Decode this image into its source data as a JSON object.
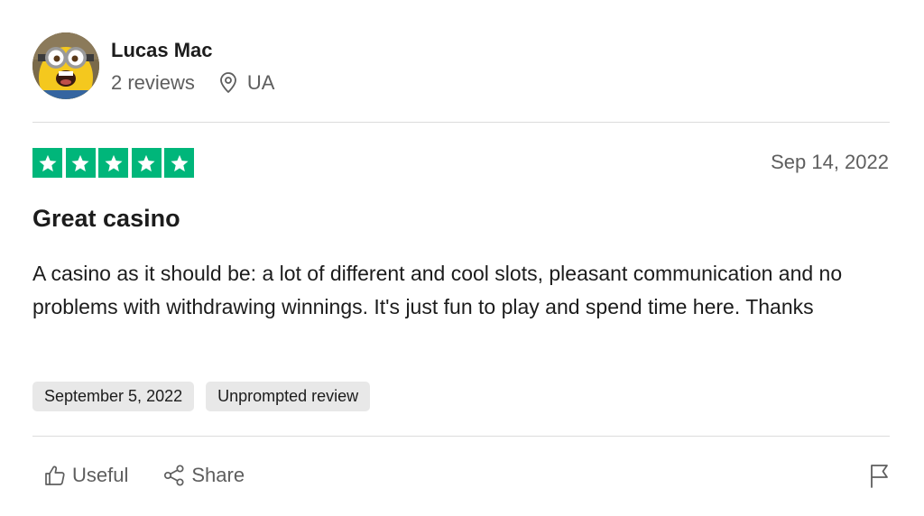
{
  "reviewer": {
    "name": "Lucas Mac",
    "reviews_count": "2 reviews",
    "location_icon": "location-pin-icon",
    "country": "UA"
  },
  "review": {
    "rating": 5,
    "rating_max": 5,
    "star_color": "#00b67a",
    "date": "Sep 14, 2022",
    "title": "Great casino",
    "body": "A casino as it should be: a lot of different and cool slots, pleasant communication and no problems with withdrawing winnings. It's just fun to play and spend time here. Thanks",
    "tags": [
      {
        "label": "September 5, 2022"
      },
      {
        "label": "Unprompted review"
      }
    ]
  },
  "actions": {
    "useful_label": "Useful",
    "useful_icon": "thumbs-up-icon",
    "share_label": "Share",
    "share_icon": "share-icon",
    "report_icon": "flag-icon"
  }
}
